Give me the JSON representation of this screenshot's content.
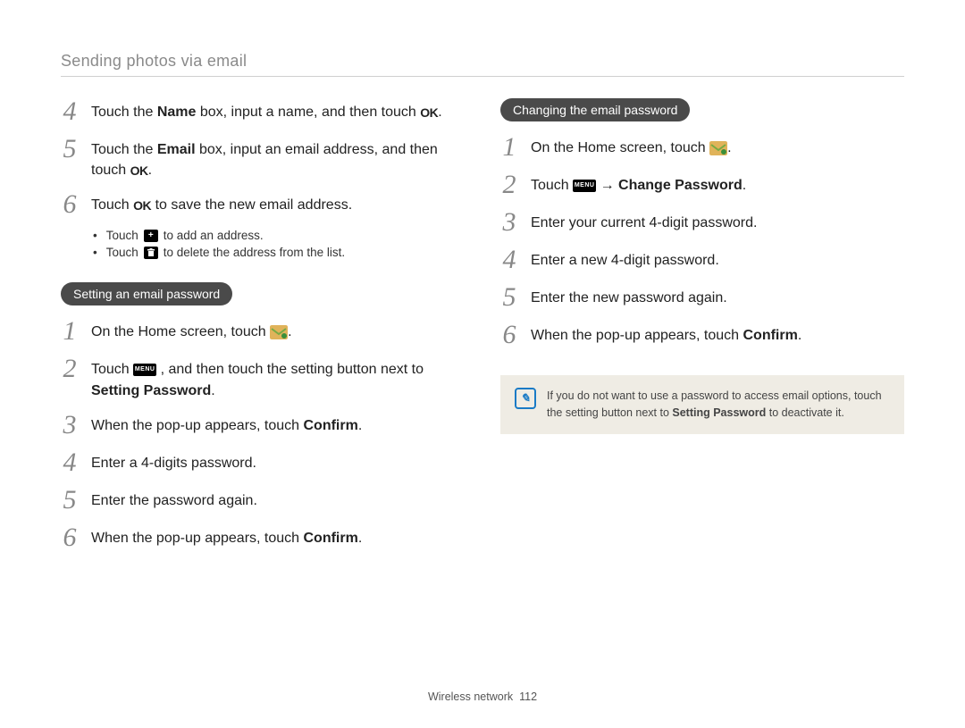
{
  "header": "Sending photos via email",
  "left": {
    "steps_a": [
      {
        "n": "4",
        "parts": [
          "Touch the ",
          "Name",
          " box, input a name, and then touch ",
          "OK",
          "."
        ]
      },
      {
        "n": "5",
        "parts": [
          "Touch the ",
          "Email",
          " box, input an email address, and then touch ",
          "OK",
          "."
        ]
      },
      {
        "n": "6",
        "parts": [
          "Touch ",
          "OK",
          " to save the new email address."
        ]
      }
    ],
    "sub_bullets": [
      {
        "pre": "Touch ",
        "icon": "plus",
        "post": " to add an address."
      },
      {
        "pre": "Touch ",
        "icon": "trash",
        "post": " to delete the address from the list."
      }
    ],
    "pill": "Setting an email password",
    "steps_b": [
      {
        "n": "1",
        "parts": [
          "On the Home screen, touch ",
          "EMAIL_ICON",
          "."
        ]
      },
      {
        "n": "2",
        "parts": [
          "Touch ",
          "MENU_ICON",
          " , and then touch the setting button next to ",
          "Setting Password",
          "."
        ]
      },
      {
        "n": "3",
        "parts": [
          "When the pop-up appears, touch ",
          "Confirm",
          "."
        ]
      },
      {
        "n": "4",
        "parts": [
          "Enter a 4-digits password."
        ]
      },
      {
        "n": "5",
        "parts": [
          "Enter the password again."
        ]
      },
      {
        "n": "6",
        "parts": [
          "When the pop-up appears, touch ",
          "Confirm",
          "."
        ]
      }
    ]
  },
  "right": {
    "pill": "Changing the email password",
    "steps": [
      {
        "n": "1",
        "parts": [
          "On the Home screen, touch ",
          "EMAIL_ICON",
          "."
        ]
      },
      {
        "n": "2",
        "parts": [
          "Touch ",
          "MENU_ICON",
          " → ",
          "Change Password",
          "."
        ]
      },
      {
        "n": "3",
        "parts": [
          "Enter your current 4-digit password."
        ]
      },
      {
        "n": "4",
        "parts": [
          "Enter a new 4-digit password."
        ]
      },
      {
        "n": "5",
        "parts": [
          "Enter the new password again."
        ]
      },
      {
        "n": "6",
        "parts": [
          "When the pop-up appears, touch ",
          "Confirm",
          "."
        ]
      }
    ],
    "note": {
      "text_pre": "If you do not want to use a password to access email options, touch the setting button next to ",
      "bold": "Setting Password",
      "text_post": " to deactivate it."
    }
  },
  "footer": {
    "label": "Wireless network",
    "page": "112"
  },
  "icons": {
    "ok": "OK",
    "plus": "+",
    "trash": "🗑",
    "menu": "MENU",
    "note": "✎"
  }
}
